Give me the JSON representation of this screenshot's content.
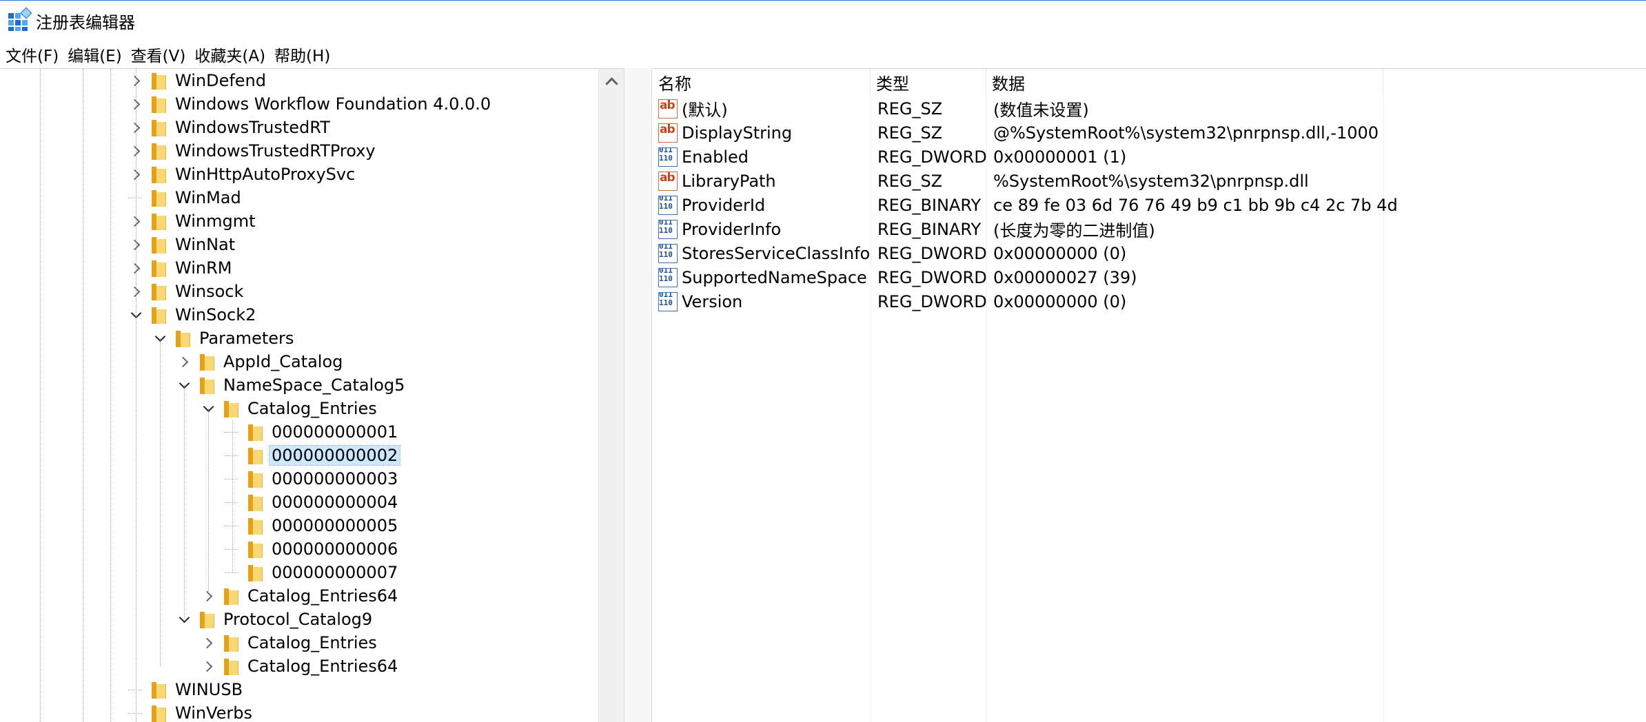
{
  "window": {
    "title": "注册表编辑器"
  },
  "menu": [
    "文件(F)",
    "编辑(E)",
    "查看(V)",
    "收藏夹(A)",
    "帮助(H)"
  ],
  "tree": [
    {
      "label": "WinDefend",
      "level": 0,
      "expander": "closed"
    },
    {
      "label": "Windows Workflow Foundation 4.0.0.0",
      "level": 0,
      "expander": "closed"
    },
    {
      "label": "WindowsTrustedRT",
      "level": 0,
      "expander": "closed"
    },
    {
      "label": "WindowsTrustedRTProxy",
      "level": 0,
      "expander": "closed"
    },
    {
      "label": "WinHttpAutoProxySvc",
      "level": 0,
      "expander": "closed"
    },
    {
      "label": "WinMad",
      "level": 0,
      "expander": "none"
    },
    {
      "label": "Winmgmt",
      "level": 0,
      "expander": "closed"
    },
    {
      "label": "WinNat",
      "level": 0,
      "expander": "closed"
    },
    {
      "label": "WinRM",
      "level": 0,
      "expander": "closed"
    },
    {
      "label": "Winsock",
      "level": 0,
      "expander": "closed"
    },
    {
      "label": "WinSock2",
      "level": 0,
      "expander": "open"
    },
    {
      "label": "Parameters",
      "level": 1,
      "expander": "open"
    },
    {
      "label": "AppId_Catalog",
      "level": 2,
      "expander": "closed"
    },
    {
      "label": "NameSpace_Catalog5",
      "level": 2,
      "expander": "open"
    },
    {
      "label": "Catalog_Entries",
      "level": 3,
      "expander": "open"
    },
    {
      "label": "000000000001",
      "level": 4,
      "expander": "none"
    },
    {
      "label": "000000000002",
      "level": 4,
      "expander": "none",
      "selected": true
    },
    {
      "label": "000000000003",
      "level": 4,
      "expander": "none"
    },
    {
      "label": "000000000004",
      "level": 4,
      "expander": "none"
    },
    {
      "label": "000000000005",
      "level": 4,
      "expander": "none"
    },
    {
      "label": "000000000006",
      "level": 4,
      "expander": "none"
    },
    {
      "label": "000000000007",
      "level": 4,
      "expander": "none"
    },
    {
      "label": "Catalog_Entries64",
      "level": 3,
      "expander": "closed"
    },
    {
      "label": "Protocol_Catalog9",
      "level": 2,
      "expander": "open"
    },
    {
      "label": "Catalog_Entries",
      "level": 3,
      "expander": "closed"
    },
    {
      "label": "Catalog_Entries64",
      "level": 3,
      "expander": "closed"
    },
    {
      "label": "WINUSB",
      "level": 0,
      "expander": "none"
    },
    {
      "label": "WinVerbs",
      "level": 0,
      "expander": "none"
    }
  ],
  "columns": {
    "name": "名称",
    "type": "类型",
    "data": "数据"
  },
  "values": [
    {
      "name": "(默认)",
      "type": "REG_SZ",
      "data": "(数值未设置)",
      "icon": "string-value-icon"
    },
    {
      "name": "DisplayString",
      "type": "REG_SZ",
      "data": "@%SystemRoot%\\system32\\pnrpnsp.dll,-1000",
      "icon": "string-value-icon"
    },
    {
      "name": "Enabled",
      "type": "REG_DWORD",
      "data": "0x00000001 (1)",
      "icon": "binary-value-icon"
    },
    {
      "name": "LibraryPath",
      "type": "REG_SZ",
      "data": "%SystemRoot%\\system32\\pnrpnsp.dll",
      "icon": "string-value-icon"
    },
    {
      "name": "ProviderId",
      "type": "REG_BINARY",
      "data": "ce 89 fe 03 6d 76 76 49 b9 c1 bb 9b c4 2c 7b 4d",
      "icon": "binary-value-icon"
    },
    {
      "name": "ProviderInfo",
      "type": "REG_BINARY",
      "data": "(长度为零的二进制值)",
      "icon": "binary-value-icon"
    },
    {
      "name": "StoresServiceClassInfo",
      "type": "REG_DWORD",
      "data": "0x00000000 (0)",
      "icon": "binary-value-icon"
    },
    {
      "name": "SupportedNameSpace",
      "type": "REG_DWORD",
      "data": "0x00000027 (39)",
      "icon": "binary-value-icon"
    },
    {
      "name": "Version",
      "type": "REG_DWORD",
      "data": "0x00000000 (0)",
      "icon": "binary-value-icon"
    }
  ]
}
